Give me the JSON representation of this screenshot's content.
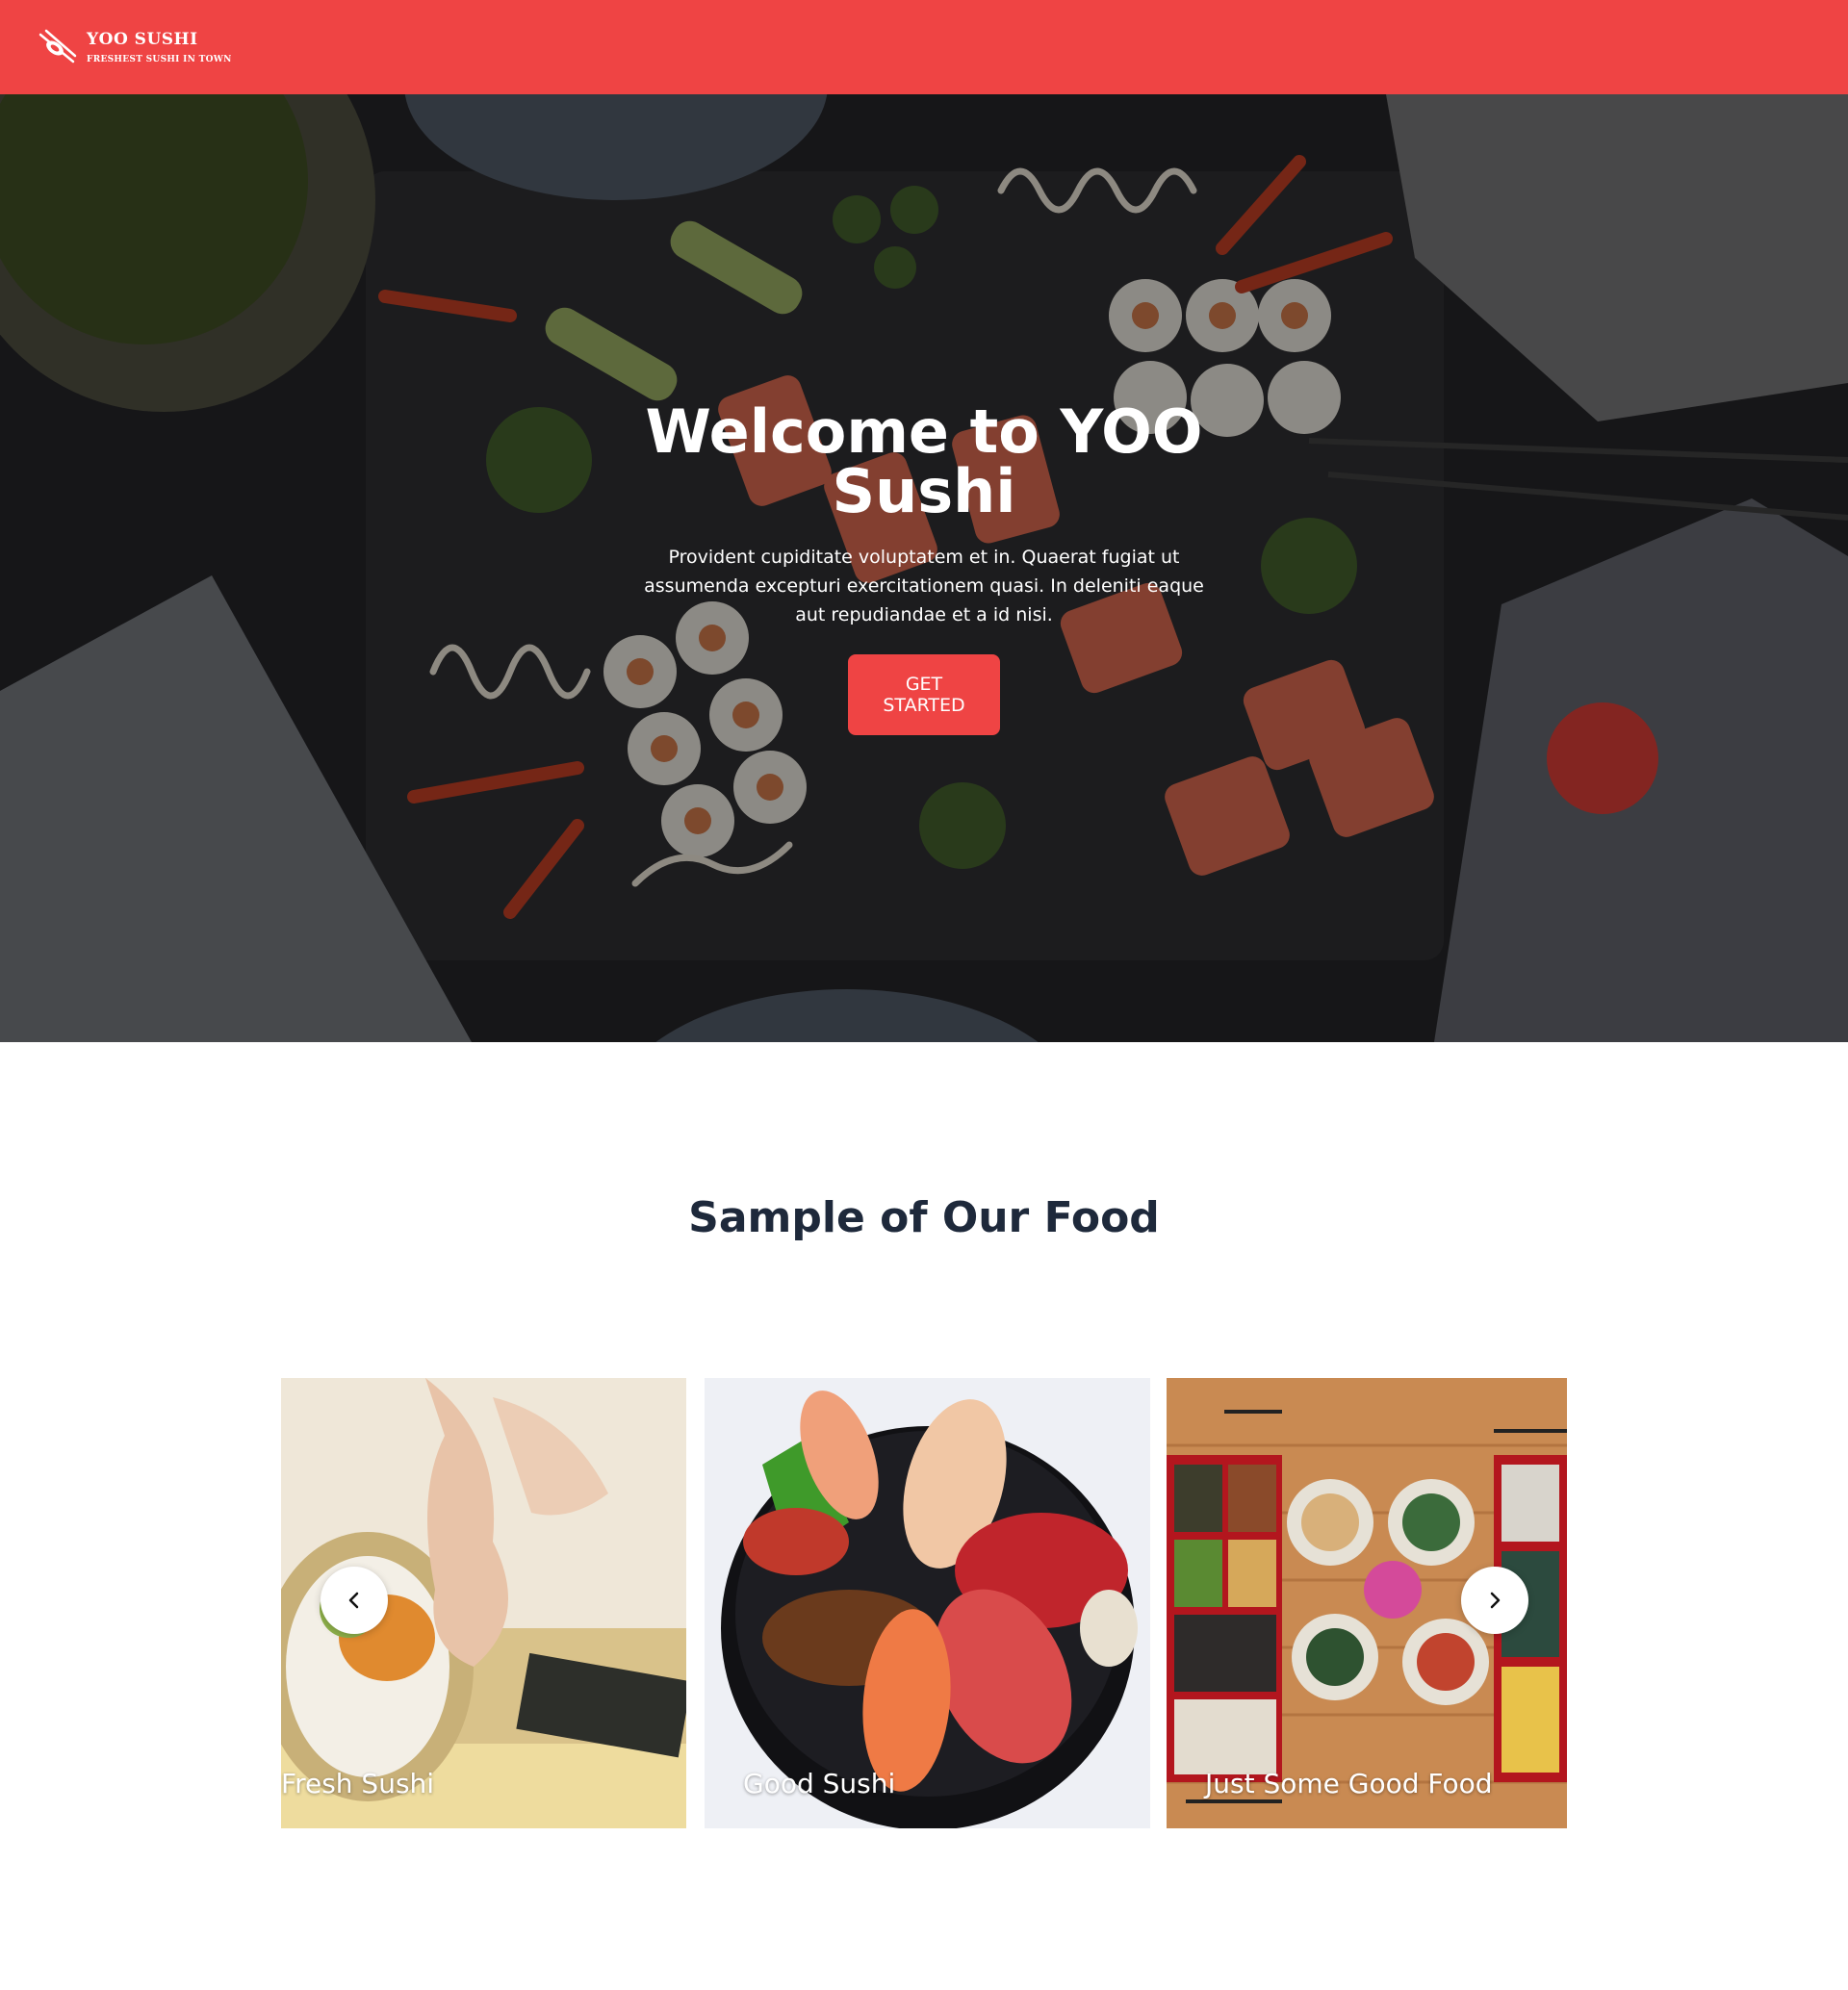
{
  "header": {
    "brand_name": "YOO SUSHI",
    "brand_tagline": "FRESHEST SUSHI IN TOWN",
    "background_color": "#ef4444",
    "logo_icon": "sushi-chopsticks-icon"
  },
  "hero": {
    "title_line1": "Welcome to YOO",
    "title_line2": "Sushi",
    "description": "Provident cupiditate voluptatem et in. Quaerat fugiat ut assumenda excepturi exercitationem quasi. In deleniti eaque aut repudiandae et a id nisi.",
    "cta_label": "GET STARTED"
  },
  "samples": {
    "title": "Sample of Our Food",
    "items": [
      {
        "caption": "Fresh Sushi"
      },
      {
        "caption": "Good Sushi"
      },
      {
        "caption": "Just Some Good Food"
      }
    ],
    "prev_icon": "chevron-left-icon",
    "next_icon": "chevron-right-icon"
  }
}
